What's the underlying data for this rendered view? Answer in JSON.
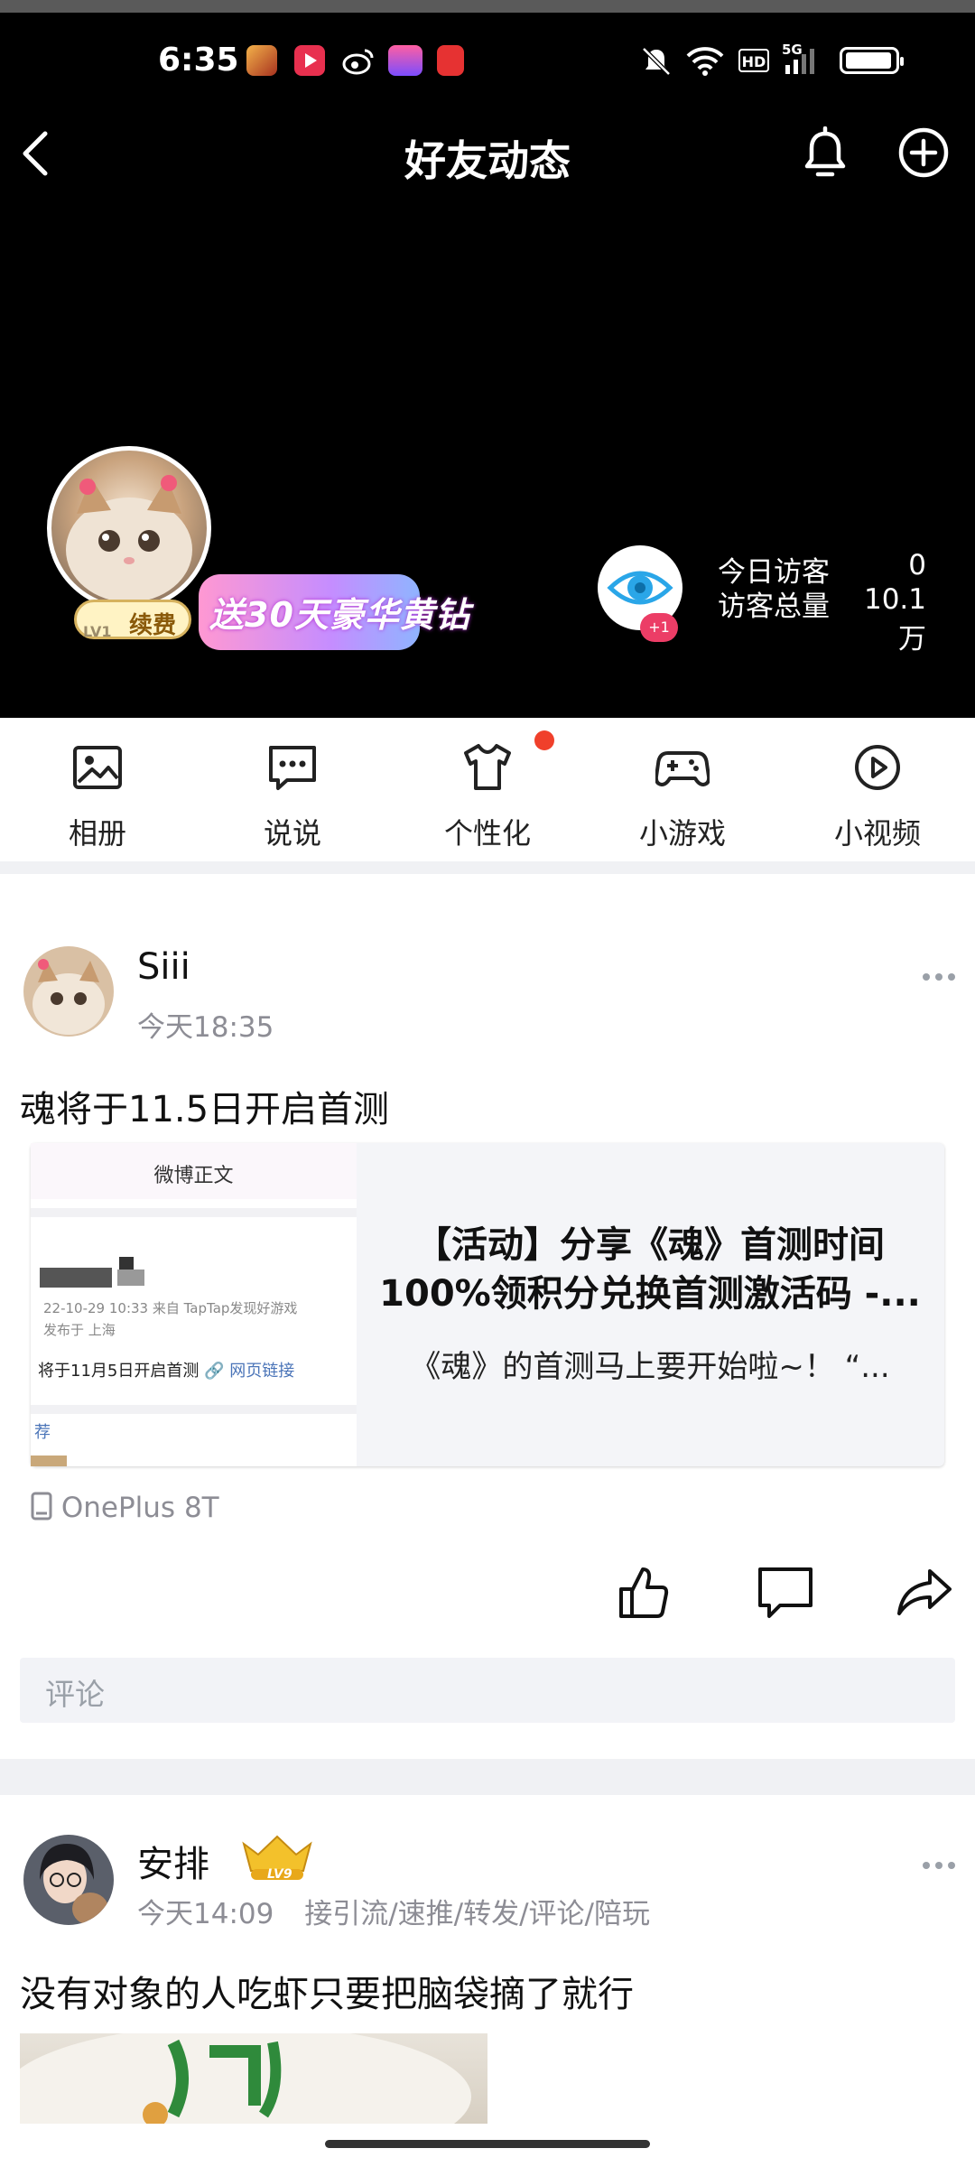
{
  "status_bar": {
    "time": "6:35",
    "app_icons": [
      "king-game-icon",
      "video-icon",
      "weibo-icon",
      "pink-app-icon",
      "shopping-icon"
    ],
    "right_icons": [
      "mute-icon",
      "wifi-icon",
      "hd-icon",
      "signal-5g-icon",
      "battery-icon"
    ],
    "hd_label": "HD",
    "network_label": "5G"
  },
  "nav": {
    "title": "好友动态"
  },
  "profile": {
    "promo_text": "送30天豪华黄钻",
    "renew_label": "续费",
    "level_label": "LV1",
    "visitor_badge": "+1",
    "today_label": "今日访客",
    "today_value": "0",
    "total_label": "访客总量",
    "total_value": "10.1万"
  },
  "quick_bar": {
    "items": [
      {
        "label": "相册",
        "icon": "photo-album-icon"
      },
      {
        "label": "说说",
        "icon": "message-icon"
      },
      {
        "label": "个性化",
        "icon": "tshirt-icon"
      },
      {
        "label": "小游戏",
        "icon": "gamepad-icon"
      },
      {
        "label": "小视频",
        "icon": "play-video-icon"
      }
    ]
  },
  "posts": [
    {
      "author": "Siii",
      "time": "今天18:35",
      "text": "魂将于11.5日开启首测",
      "card": {
        "thumb_header": "微博正文",
        "thumb_meta_1": "22-10-29 10:33  来自 TapTap发现好游戏",
        "thumb_meta_2": "发布于 上海",
        "thumb_body": "将于11月5日开启首测",
        "thumb_link": "网页链接",
        "thumb_footer": "荐",
        "title": "【活动】分享《魂》首测时间100%领积分兑换首测激活码 -...",
        "summary": "《魂》的首测马上要开始啦~！ “..."
      },
      "device": "OnePlus 8T",
      "comment_placeholder": "评论"
    },
    {
      "author": "安排",
      "badge_level": "LV9",
      "time": "今天14:09",
      "tags": "接引流/速推/转发/评论/陪玩",
      "text": "没有对象的人吃虾只要把脑袋摘了就行"
    }
  ],
  "colors": {
    "header_bg": "#000000",
    "accent_red": "#f0402b",
    "badge_pink": "#ec3d66",
    "eye_blue": "#2aa6e8",
    "separator": "#f0f1f4"
  }
}
